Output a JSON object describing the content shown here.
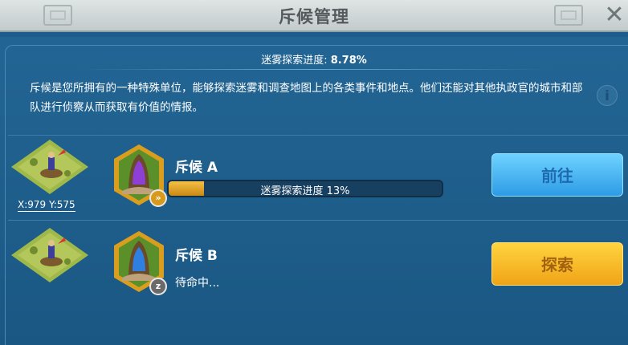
{
  "header": {
    "title": "斥候管理"
  },
  "fog": {
    "label": "迷雾探索进度: ",
    "value": "8.78%"
  },
  "description": "斥候是您所拥有的一种特殊单位，能够探索迷雾和调查地图上的各类事件和地点。他们还能对其他执政官的城市和部队进行侦察从而获取有价值的情报。",
  "scouts": [
    {
      "name": "斥候  A",
      "coords": "X:979 Y:575",
      "progress_text": "迷雾探索进度 13%",
      "progress_fraction": 0.13,
      "badge_icon": "scout-march-icon",
      "hood_color": "#8e3fd6",
      "button_label": "前往"
    },
    {
      "name": "斥候  B",
      "status_text": "待命中...",
      "badge_icon": "sleep-icon",
      "badge_text": "z",
      "hood_color": "#2f7fe0",
      "button_label": "探索"
    }
  ],
  "colors": {
    "panel": "#1d5c8c",
    "button_blue": "#4bb8f4",
    "button_orange": "#f7b928",
    "progress_fill": "#e0a52a"
  }
}
